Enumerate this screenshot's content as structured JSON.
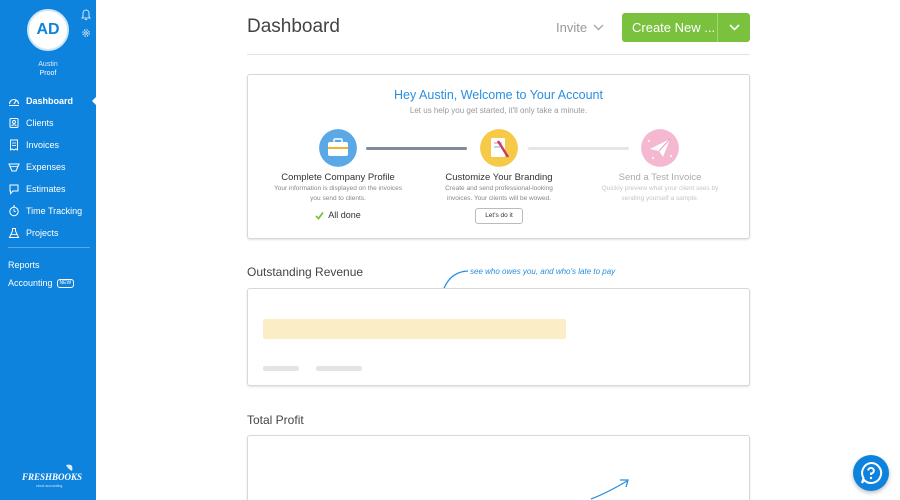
{
  "user": {
    "initials": "AD",
    "first_name": "Austin",
    "last_name": "Proof"
  },
  "sidebar": {
    "items": [
      {
        "label": "Dashboard",
        "icon": "dashboard-icon"
      },
      {
        "label": "Clients",
        "icon": "clients-icon"
      },
      {
        "label": "Invoices",
        "icon": "invoices-icon"
      },
      {
        "label": "Expenses",
        "icon": "expenses-icon"
      },
      {
        "label": "Estimates",
        "icon": "estimates-icon"
      },
      {
        "label": "Time Tracking",
        "icon": "clock-icon"
      },
      {
        "label": "Projects",
        "icon": "projects-icon"
      }
    ],
    "reports": "Reports",
    "accounting": "Accounting",
    "new_badge": "NEW",
    "logo_text": "FRESHBOOKS",
    "logo_sub": "cloud accounting"
  },
  "header": {
    "title": "Dashboard",
    "invite": "Invite",
    "create_new": "Create New ..."
  },
  "welcome": {
    "title": "Hey Austin, Welcome to Your Account",
    "subtitle": "Let us help you get started, it'll only take a minute.",
    "steps": [
      {
        "title": "Complete Company Profile",
        "desc1": "Your information is displayed on the invoices",
        "desc2": "you send to clients.",
        "status": "All done",
        "icon": "briefcase-icon"
      },
      {
        "title": "Customize Your Branding",
        "desc1": "Create and send professional-looking",
        "desc2": "invoices. Your clients will be wowed.",
        "action": "Let's do it",
        "icon": "paintbrush-icon"
      },
      {
        "title": "Send a Test Invoice",
        "desc1": "Quickly preview what your client sees by",
        "desc2": "sending yourself a sample.",
        "icon": "paper-plane-icon"
      }
    ]
  },
  "outstanding": {
    "title": "Outstanding Revenue",
    "annotation": "see who owes you, and who's late to pay"
  },
  "profit": {
    "title": "Total Profit"
  },
  "colors": {
    "sidebar": "#0d83dd",
    "accent": "#7ac13e",
    "link": "#2a8fe0"
  }
}
